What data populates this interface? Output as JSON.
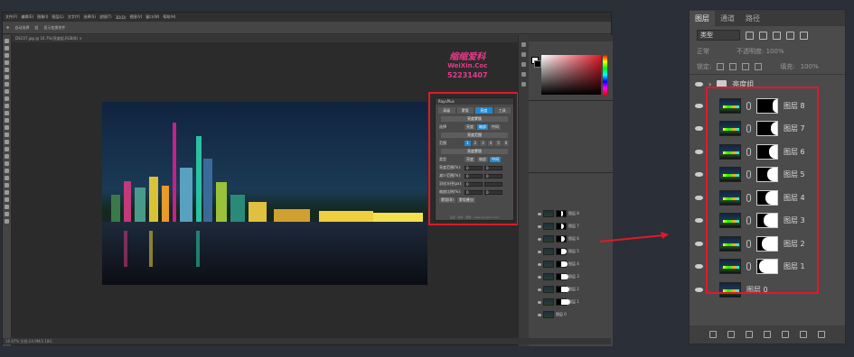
{
  "ps": {
    "menu": [
      "文件(F)",
      "编辑(E)",
      "图像(I)",
      "图层(L)",
      "文字(Y)",
      "选择(S)",
      "滤镜(T)",
      "3D(D)",
      "视图(V)",
      "窗口(W)",
      "帮助(H)"
    ],
    "options": [
      "自动选择",
      "组",
      "显示变换控件"
    ],
    "doc_tab": "DSC07.jpg @ 16.7%(亮度组,RGB/8) ×",
    "status": "16.67%  文档:24.9M/2.18G"
  },
  "watermark": {
    "line1": "缩缩爱科",
    "line2": "WeiXin.Coc",
    "line3": "52231407"
  },
  "plugin": {
    "title": "RaysPlus",
    "tabs": [
      "高级",
      "蒙版",
      "亮度",
      "工具"
    ],
    "active_tab": 2,
    "head1": "亮度蒙版",
    "row1_label": "选择",
    "row1_btns": [
      "亮度",
      "暗部",
      "中间"
    ],
    "head2": "亮度范围",
    "range_label": "范围",
    "range_btns": [
      "1",
      "2",
      "3",
      "4",
      "5",
      "6"
    ],
    "head3": "亮度蒙版",
    "row3_label": "类型",
    "row3_btns": [
      "亮度",
      "暗部",
      "中间"
    ],
    "fields": [
      {
        "label": "亮度范围(%):",
        "a": "0",
        "b": "0"
      },
      {
        "label": "减少范围(%):",
        "a": "0",
        "b": "0"
      },
      {
        "label": "羽化半径(px):",
        "a": "0",
        "b": ""
      },
      {
        "label": "缩放比例(%):",
        "a": "0",
        "b": "0"
      }
    ],
    "btn_a": "蒙版(B)",
    "btn_b": "蒙版叠加",
    "footer": "设置 · 版本 · 帮助 · www.raysplus.com"
  },
  "mini_layers": [
    {
      "name": "图层 8",
      "mask": 0.2
    },
    {
      "name": "图层 7",
      "mask": 0.3
    },
    {
      "name": "图层 6",
      "mask": 0.4
    },
    {
      "name": "图层 5",
      "mask": 0.5
    },
    {
      "name": "图层 4",
      "mask": 0.6
    },
    {
      "name": "图层 3",
      "mask": 0.7
    },
    {
      "name": "图层 2",
      "mask": 0.8
    },
    {
      "name": "图层 1",
      "mask": 0.9
    },
    {
      "name": "图层 0",
      "mask": null
    }
  ],
  "layers_panel": {
    "tabs": [
      "图层",
      "通道",
      "路径"
    ],
    "active_tab": 0,
    "kind_select": "类型",
    "blend_mode": "正常",
    "opacity_label": "不透明度:",
    "opacity": "100%",
    "lock_label": "锁定:",
    "fill_label": "填充:",
    "fill": "100%",
    "group_name": "亮度组",
    "layers": [
      {
        "name": "图层 8",
        "mask": 0.22
      },
      {
        "name": "图层 7",
        "mask": 0.3
      },
      {
        "name": "图层 6",
        "mask": 0.38
      },
      {
        "name": "图层 5",
        "mask": 0.46
      },
      {
        "name": "图层 4",
        "mask": 0.54
      },
      {
        "name": "图层 3",
        "mask": 0.62
      },
      {
        "name": "图层 2",
        "mask": 0.72
      },
      {
        "name": "图层 1",
        "mask": 0.82
      },
      {
        "name": "图层 0",
        "mask": null
      }
    ]
  },
  "colors": {
    "highlight": "#e0192a",
    "accent": "#1e88d2"
  }
}
